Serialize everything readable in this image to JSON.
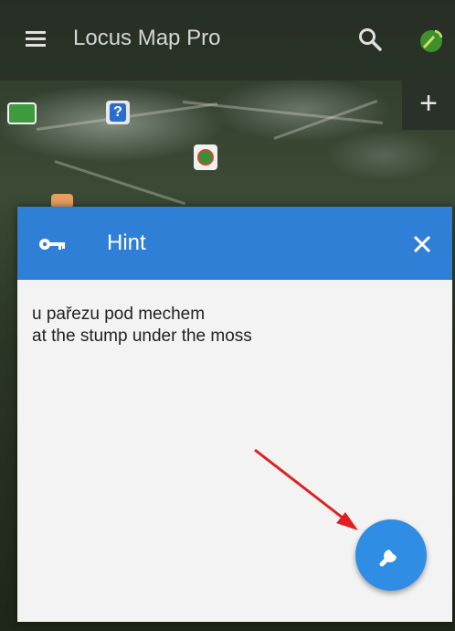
{
  "app_bar": {
    "title": "Locus Map Pro",
    "menu_icon": "hamburger-menu-icon",
    "search_icon": "search-icon",
    "gps_icon": "gps-status-icon"
  },
  "map": {
    "zoom_in_label": "+"
  },
  "dialog": {
    "title": "Hint",
    "header_icon": "key-icon",
    "close_icon": "close-icon",
    "hint_lines": [
      "u pařezu pod mechem",
      "at the stump under the moss"
    ],
    "action_icon": "wrench-icon",
    "header_color": "#2f7fd7",
    "fab_color": "#2f8de4",
    "annotation_color": "#e02020"
  }
}
